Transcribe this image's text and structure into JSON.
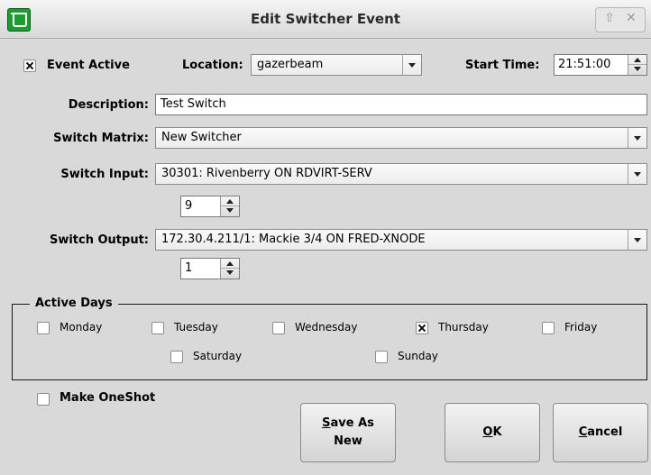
{
  "window": {
    "title": "Edit Switcher Event"
  },
  "event_active": {
    "label": "Event Active",
    "checked": true
  },
  "location": {
    "label": "Location:",
    "value": "gazerbeam"
  },
  "start_time": {
    "label": "Start Time:",
    "value": "21:51:00"
  },
  "description": {
    "label": "Description:",
    "value": "Test Switch"
  },
  "switch_matrix": {
    "label": "Switch Matrix:",
    "value": "New Switcher"
  },
  "switch_input": {
    "label": "Switch Input:",
    "value": "30301: Rivenberry ON RDVIRT-SERV",
    "number": "9"
  },
  "switch_output": {
    "label": "Switch Output:",
    "value": "172.30.4.211/1: Mackie 3/4 ON FRED-XNODE",
    "number": "1"
  },
  "active_days": {
    "title": "Active Days",
    "days": [
      {
        "label": "Monday",
        "checked": false
      },
      {
        "label": "Tuesday",
        "checked": false
      },
      {
        "label": "Wednesday",
        "checked": false
      },
      {
        "label": "Thursday",
        "checked": true
      },
      {
        "label": "Friday",
        "checked": false
      },
      {
        "label": "Saturday",
        "checked": false
      },
      {
        "label": "Sunday",
        "checked": false
      }
    ]
  },
  "make_oneshot": {
    "label": "Make OneShot",
    "checked": false
  },
  "buttons": {
    "save_as_new_line1": "Save As",
    "save_as_new_line2": "New",
    "ok": "OK",
    "cancel": "Cancel"
  },
  "icons": {
    "app": "app-logo-icon",
    "up": "up-arrow-icon",
    "close": "close-icon"
  }
}
